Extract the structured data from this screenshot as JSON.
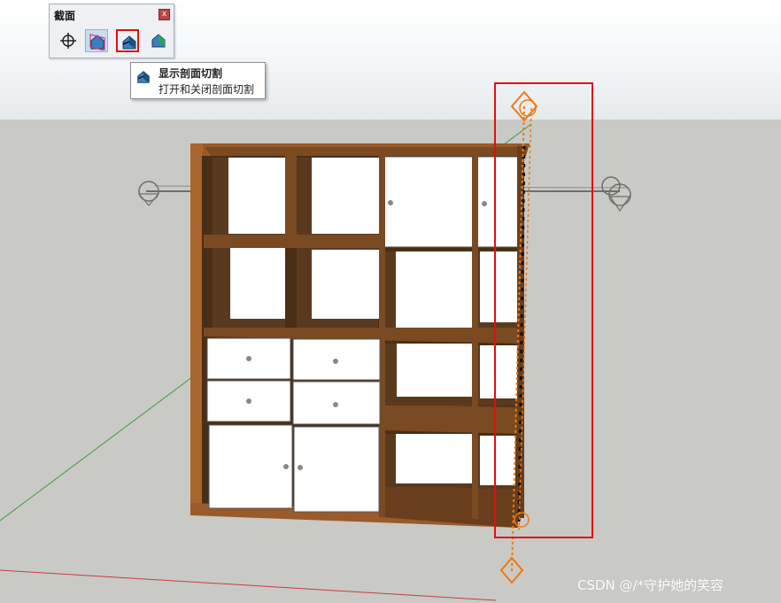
{
  "toolbar": {
    "title": "截面",
    "close_label": "x",
    "buttons": [
      {
        "name": "section-plane",
        "icon": "section-plane-icon"
      },
      {
        "name": "display-section-planes",
        "icon": "display-section-planes-icon"
      },
      {
        "name": "display-section-cuts",
        "icon": "display-section-cuts-icon",
        "highlighted": true
      },
      {
        "name": "display-section-fill",
        "icon": "display-section-fill-icon"
      }
    ]
  },
  "tooltip": {
    "title": "显示剖面切割",
    "description": "打开和关闭剖面切割"
  },
  "watermark": "CSDN @/*守护她的笑容",
  "colors": {
    "sky_top": "#ffffff",
    "ground": "#c9c9c5",
    "wood": "#5a3a1f",
    "wood_edge": "#9a5a2a",
    "door_white": "#ffffff",
    "section_orange": "#f07a10",
    "highlight_red": "#e01010",
    "axis_green": "#3aa03a",
    "axis_red": "#c04040"
  }
}
